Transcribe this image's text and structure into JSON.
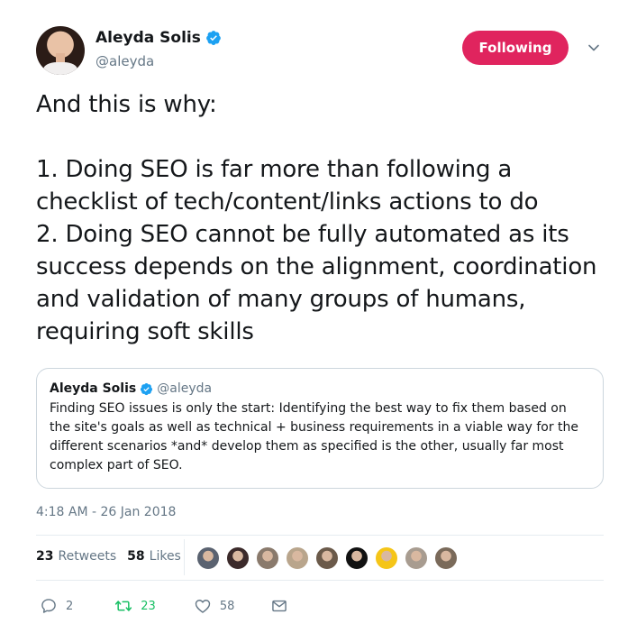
{
  "author": {
    "name": "Aleyda Solis",
    "handle": "@aleyda"
  },
  "follow_button": {
    "label": "Following",
    "color": "#e0245e"
  },
  "tweet": {
    "text": "And this is why:\n\n1. Doing SEO is far more than following a checklist of tech/content/links actions  to do\n2. Doing SEO cannot be fully automated as its success depends on the alignment, coordination and validation of many groups of humans, requiring soft skills"
  },
  "quoted_tweet": {
    "name": "Aleyda Solis",
    "handle": "@aleyda",
    "text": "Finding SEO issues is only the start: Identifying the best way to fix them based on the site's goals as well as technical + business requirements in a viable way for the different scenarios *and* develop them as specified is the other, usually far most complex part of SEO."
  },
  "timestamp": "4:18 AM - 26 Jan 2018",
  "stats": {
    "retweets_count": "23",
    "retweets_label": "Retweets",
    "likes_count": "58",
    "likes_label": "Likes"
  },
  "likers_colors": [
    "#5a6270",
    "#3b2a2a",
    "#8a7a6c",
    "#b9a58c",
    "#6b5a4a",
    "#111111",
    "#f5c518",
    "#a89c90",
    "#7a6a5a"
  ],
  "actions": {
    "reply_count": "2",
    "retweet_count": "23",
    "like_count": "58"
  },
  "colors": {
    "verified": "#1da1f2",
    "retweet_active": "#17bf63",
    "muted_text": "#657786"
  },
  "icons": [
    "verified-badge-icon",
    "chevron-down-icon",
    "reply-icon",
    "retweet-icon",
    "like-icon",
    "direct-message-icon"
  ]
}
